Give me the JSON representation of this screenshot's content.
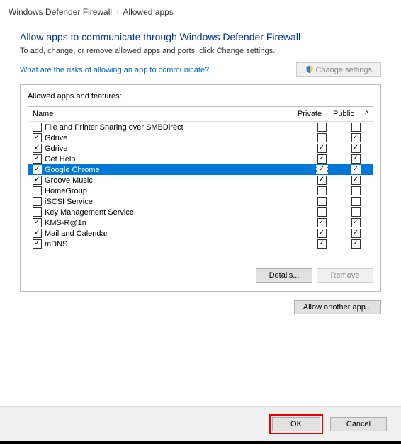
{
  "breadcrumb": {
    "root": "Windows Defender Firewall",
    "current": "Allowed apps"
  },
  "heading": "Allow apps to communicate through Windows Defender Firewall",
  "subtext": "To add, change, or remove allowed apps and ports, click Change settings.",
  "risk_link": "What are the risks of allowing an app to communicate?",
  "change_settings_label": "Change settings",
  "panel_title": "Allowed apps and features:",
  "columns": {
    "name": "Name",
    "private": "Private",
    "public": "Public"
  },
  "rows": [
    {
      "name": "File and Printer Sharing over SMBDirect",
      "enabled": false,
      "private": false,
      "public": false,
      "selected": false
    },
    {
      "name": "Gdrive",
      "enabled": true,
      "private": false,
      "public": true,
      "selected": false
    },
    {
      "name": "Gdrive",
      "enabled": true,
      "private": true,
      "public": true,
      "selected": false
    },
    {
      "name": "Get Help",
      "enabled": true,
      "private": true,
      "public": true,
      "selected": false
    },
    {
      "name": "Google Chrome",
      "enabled": true,
      "private": true,
      "public": true,
      "selected": true,
      "focus": "private"
    },
    {
      "name": "Groove Music",
      "enabled": true,
      "private": true,
      "public": true,
      "selected": false
    },
    {
      "name": "HomeGroup",
      "enabled": false,
      "private": false,
      "public": false,
      "selected": false
    },
    {
      "name": "iSCSI Service",
      "enabled": false,
      "private": false,
      "public": false,
      "selected": false
    },
    {
      "name": "Key Management Service",
      "enabled": false,
      "private": false,
      "public": false,
      "selected": false
    },
    {
      "name": "KMS-R@1n",
      "enabled": true,
      "private": true,
      "public": true,
      "selected": false
    },
    {
      "name": "Mail and Calendar",
      "enabled": true,
      "private": true,
      "public": true,
      "selected": false
    },
    {
      "name": "mDNS",
      "enabled": true,
      "private": true,
      "public": true,
      "selected": false
    }
  ],
  "buttons": {
    "details": "Details...",
    "remove": "Remove",
    "allow_another": "Allow another app...",
    "ok": "OK",
    "cancel": "Cancel"
  }
}
